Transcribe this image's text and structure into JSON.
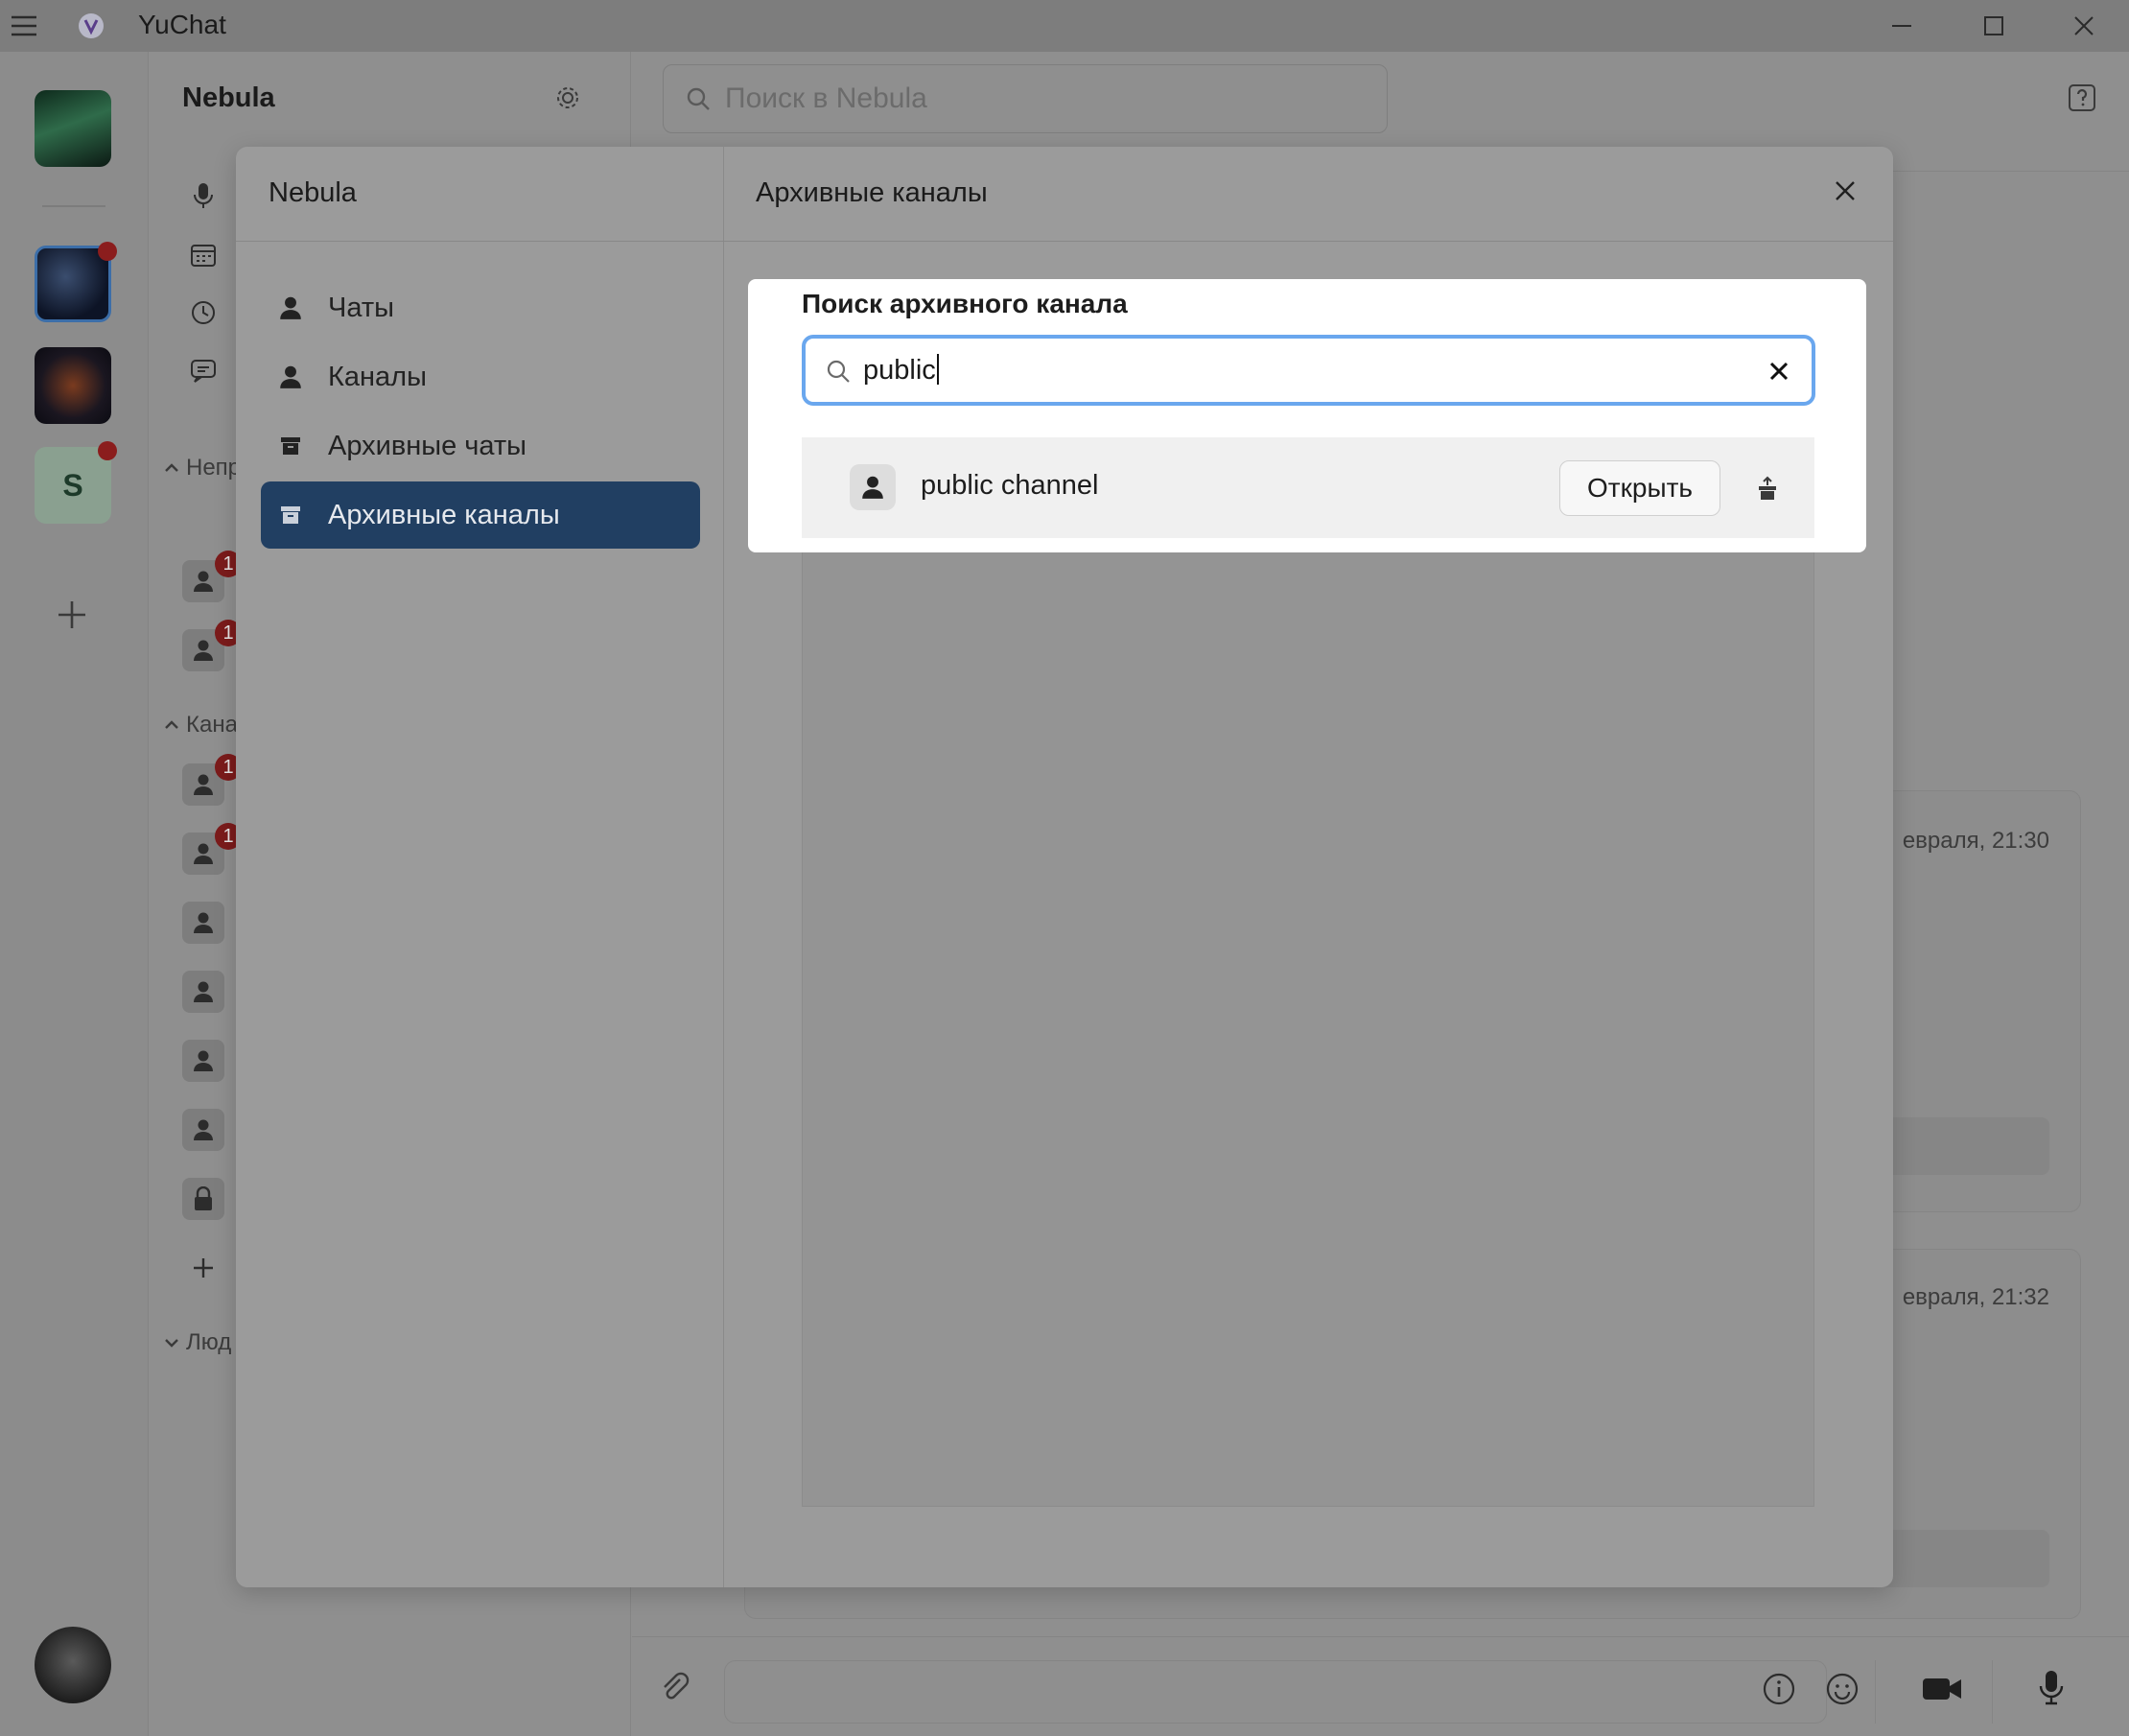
{
  "window": {
    "title": "YuChat"
  },
  "workspace": {
    "name": "Nebula",
    "search_placeholder": "Поиск в Nebula",
    "sections": {
      "unread_partial": "Непр",
      "channels_partial": "Кана",
      "people_partial": "Люд"
    },
    "unread_badges": [
      "1",
      "1"
    ],
    "channel_badges": [
      "1",
      "1"
    ],
    "servers": [
      {
        "letter": "",
        "unread": false
      },
      {
        "letter": "",
        "unread": true
      },
      {
        "letter": "",
        "unread": false
      },
      {
        "letter": "S",
        "unread": true
      }
    ]
  },
  "chat": {
    "message_times": [
      "евраля, 21:30",
      "евраля, 21:32"
    ]
  },
  "modal": {
    "left_title": "Nebula",
    "right_title": "Архивные каналы",
    "nav": [
      {
        "label": "Чаты",
        "icon": "person-icon",
        "active": false
      },
      {
        "label": "Каналы",
        "icon": "person-icon",
        "active": false
      },
      {
        "label": "Архивные чаты",
        "icon": "archive-icon",
        "active": false
      },
      {
        "label": "Архивные каналы",
        "icon": "archive-icon",
        "active": true
      }
    ]
  },
  "archive_search": {
    "label": "Поиск архивного канала",
    "value": "public",
    "results": [
      {
        "name": "public channel",
        "open_label": "Открыть"
      }
    ]
  },
  "colors": {
    "accent": "#6aa7ee",
    "active_nav": "#213f62",
    "badge": "#7b1b1b"
  }
}
